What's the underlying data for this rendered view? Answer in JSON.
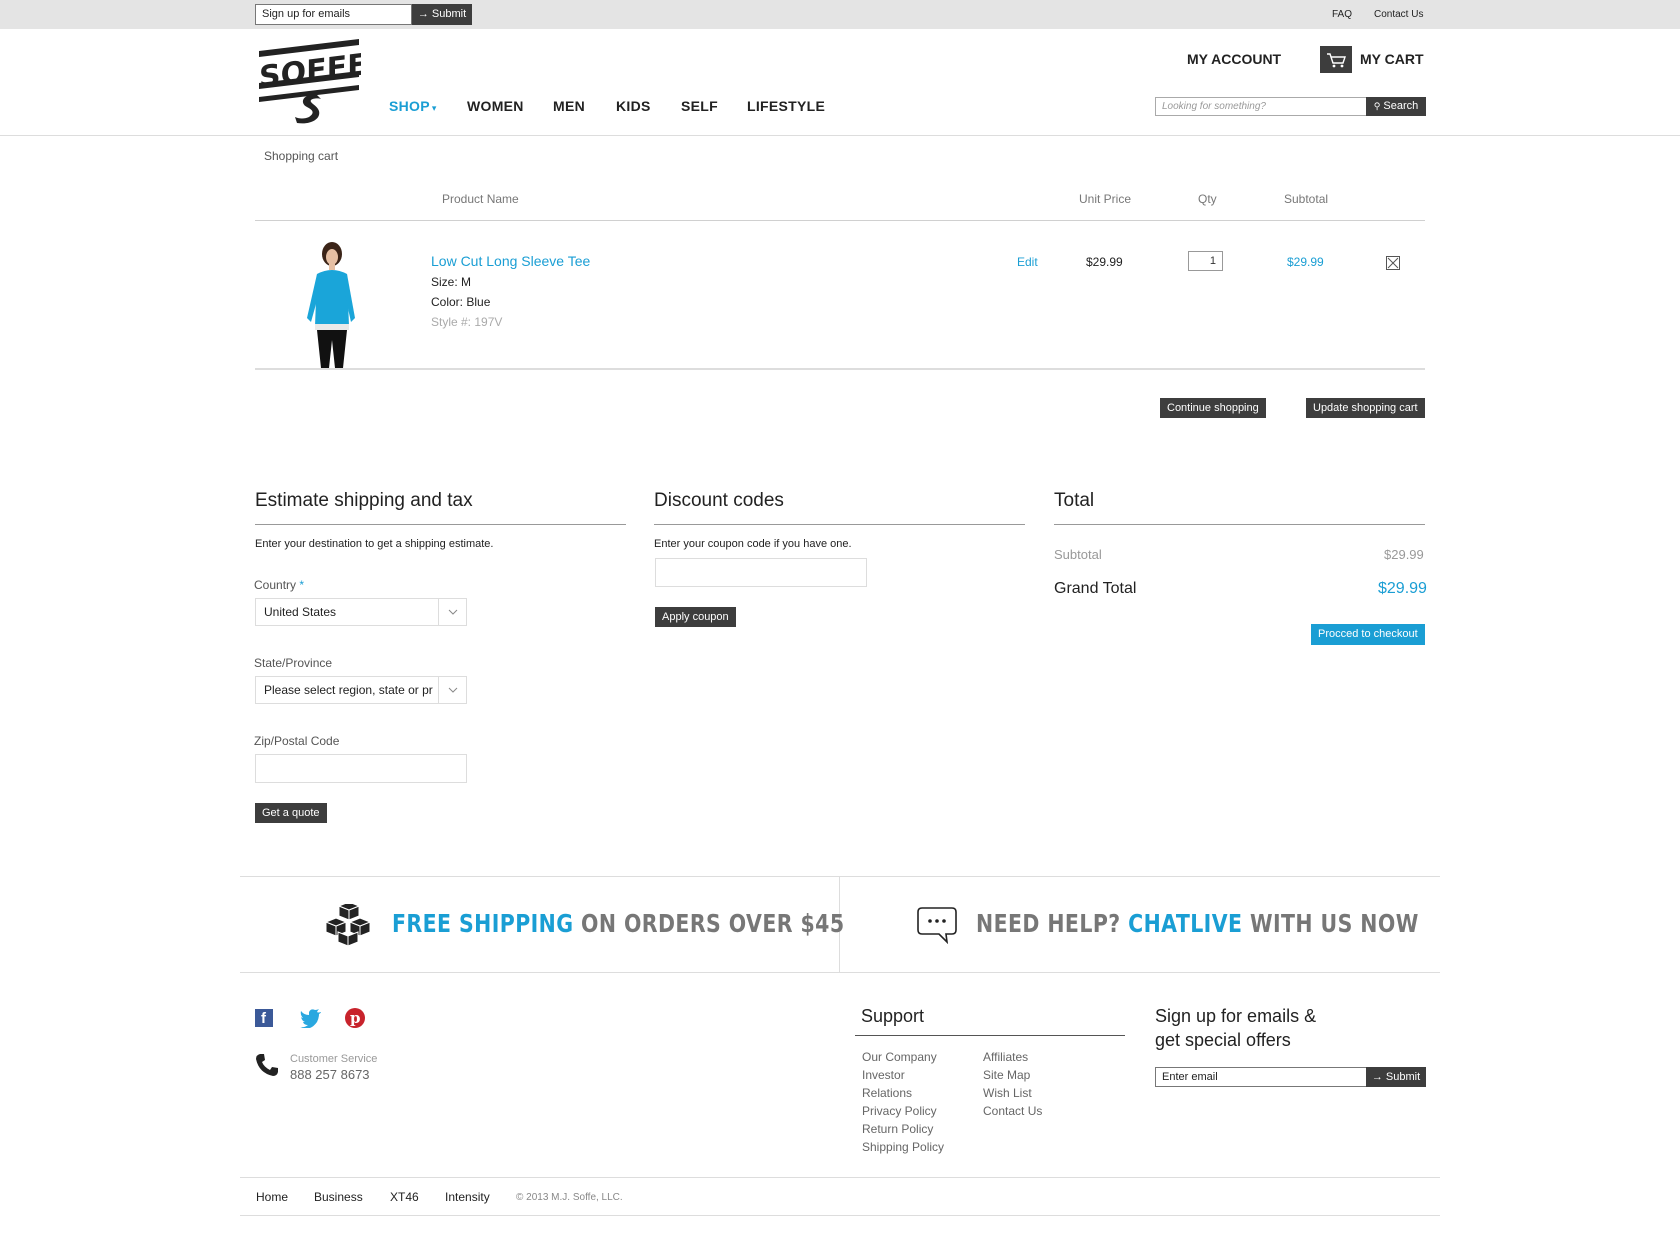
{
  "topbar": {
    "signup_placeholder": "Sign up for emails",
    "submit_label": "→ Submit",
    "faq": "FAQ",
    "contact": "Contact Us"
  },
  "header": {
    "logo_text": "SOFFE",
    "nav": [
      "SHOP",
      "WOMEN",
      "MEN",
      "KIDS",
      "SELF",
      "LIFESTYLE"
    ],
    "account": "MY ACCOUNT",
    "cart": "MY CART",
    "search_placeholder": "Looking for something?",
    "search_label": "Search"
  },
  "breadcrumb": "Shopping cart",
  "cart_table": {
    "headers": {
      "product": "Product Name",
      "unit_price": "Unit Price",
      "qty": "Qty",
      "subtotal": "Subtotal"
    },
    "item": {
      "name": "Low Cut Long Sleeve Tee",
      "size": "Size: M",
      "color": "Color: Blue",
      "style": "Style #: 197V",
      "edit": "Edit",
      "unit_price": "$29.99",
      "qty": "1",
      "subtotal": "$29.99"
    },
    "continue": "Continue shopping",
    "update": "Update shopping cart"
  },
  "shipping": {
    "title": "Estimate shipping and tax",
    "intro": "Enter your destination to get a shipping estimate.",
    "country_label": "Country",
    "required": "*",
    "country_value": "United States",
    "state_label": "State/Province",
    "state_value": "Please select region, state or pr",
    "zip_label": "Zip/Postal Code",
    "quote": "Get a quote"
  },
  "discount": {
    "title": "Discount codes",
    "intro": "Enter your coupon code if you have one.",
    "apply": "Apply coupon"
  },
  "totals": {
    "title": "Total",
    "subtotal_label": "Subtotal",
    "subtotal": "$29.99",
    "grand_label": "Grand Total",
    "grand": "$29.99",
    "checkout": "Procced to checkout"
  },
  "banners": {
    "ship_a": "FREE SHIPPING",
    "ship_b": " ON ORDERS OVER $45",
    "help_a": "NEED HELP? ",
    "help_b": "CHATLIVE",
    "help_c": " WITH US NOW"
  },
  "footer": {
    "cs_label": "Customer Service",
    "cs_phone": "888 257 8673",
    "support_title": "Support",
    "support_col1": [
      "Our Company",
      "Investor",
      "Relations",
      "Privacy Policy",
      "Return Policy",
      "Shipping Policy"
    ],
    "support_col2": [
      "Affiliates",
      "Site Map",
      "Wish List",
      "Contact Us"
    ],
    "signup_title_1": "Sign up for emails &",
    "signup_title_2": "get special offers",
    "email_placeholder": "Enter email",
    "submit": "→ Submit",
    "bottom_links": [
      "Home",
      "Business",
      "XT46",
      "Intensity"
    ],
    "copyright": "© 2013 M.J. Soffe, LLC."
  },
  "colors": {
    "accent": "#1a9ed4",
    "dark": "#3d3d3d"
  }
}
